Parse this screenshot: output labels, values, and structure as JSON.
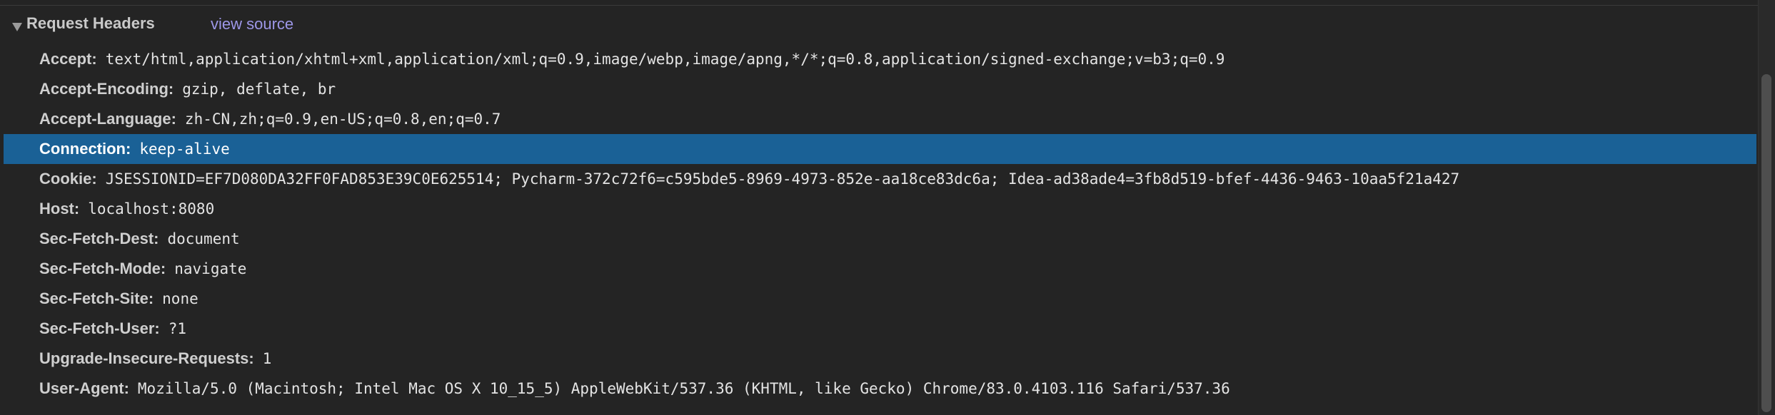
{
  "section": {
    "title": "Request Headers",
    "view_source_label": "view source"
  },
  "headers": [
    {
      "name": "Accept",
      "value": "text/html,application/xhtml+xml,application/xml;q=0.9,image/webp,image/apng,*/*;q=0.8,application/signed-exchange;v=b3;q=0.9"
    },
    {
      "name": "Accept-Encoding",
      "value": "gzip, deflate, br"
    },
    {
      "name": "Accept-Language",
      "value": "zh-CN,zh;q=0.9,en-US;q=0.8,en;q=0.7"
    },
    {
      "name": "Connection",
      "value": "keep-alive",
      "selected": true
    },
    {
      "name": "Cookie",
      "value": "JSESSIONID=EF7D080DA32FF0FAD853E39C0E625514; Pycharm-372c72f6=c595bde5-8969-4973-852e-aa18ce83dc6a; Idea-ad38ade4=3fb8d519-bfef-4436-9463-10aa5f21a427"
    },
    {
      "name": "Host",
      "value": "localhost:8080"
    },
    {
      "name": "Sec-Fetch-Dest",
      "value": "document"
    },
    {
      "name": "Sec-Fetch-Mode",
      "value": "navigate"
    },
    {
      "name": "Sec-Fetch-Site",
      "value": "none"
    },
    {
      "name": "Sec-Fetch-User",
      "value": "?1"
    },
    {
      "name": "Upgrade-Insecure-Requests",
      "value": "1"
    },
    {
      "name": "User-Agent",
      "value": "Mozilla/5.0 (Macintosh; Intel Mac OS X 10_15_5) AppleWebKit/537.36 (KHTML, like Gecko) Chrome/83.0.4103.116 Safari/537.36"
    }
  ],
  "colors": {
    "background": "#242424",
    "selected_row": "#1a6196",
    "link": "#9d97e8"
  },
  "icons": {
    "toggle": "triangle-down-icon"
  }
}
